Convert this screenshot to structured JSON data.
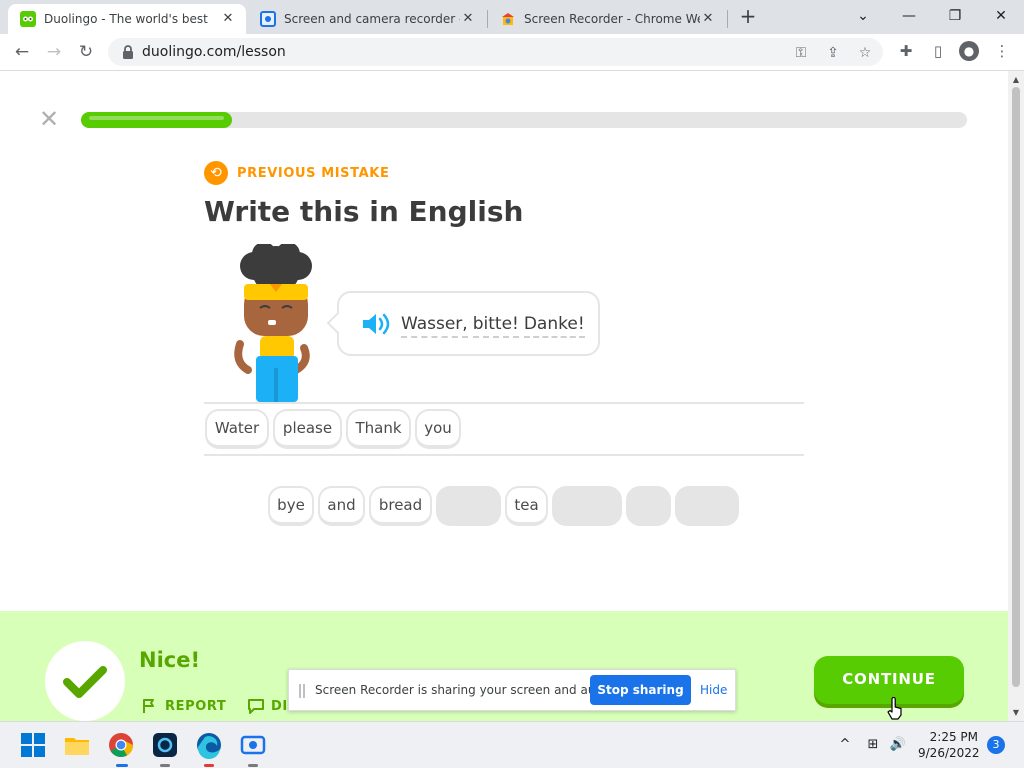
{
  "browser": {
    "tabs": [
      {
        "title": "Duolingo - The world's best"
      },
      {
        "title": "Screen and camera recorder - Sc"
      },
      {
        "title": "Screen Recorder - Chrome Web"
      }
    ],
    "url": "duolingo.com/lesson"
  },
  "lesson": {
    "progress": 0.17,
    "badge_label": "PREVIOUS MISTAKE",
    "heading": "Write this in English",
    "phrase_words": [
      "Wasser,",
      "bitte!",
      "Danke!"
    ],
    "answer_chips": [
      "Water",
      "please",
      "Thank",
      "you"
    ],
    "bank_chips": [
      "bye",
      "and",
      "bread",
      "",
      "tea",
      "",
      "",
      ""
    ]
  },
  "feedback": {
    "title": "Nice!",
    "report_label": "REPORT",
    "discuss_label": "DI",
    "continue_label": "CONTINUE"
  },
  "sharing_bar": {
    "message": "Screen Recorder is sharing your screen and audio.",
    "stop_label": "Stop sharing",
    "hide_label": "Hide"
  },
  "taskbar": {
    "time": "2:25 PM",
    "date": "9/26/2022",
    "notification_count": "3"
  },
  "colors": {
    "duo_green": "#58cc02",
    "duo_green_dark": "#58a700",
    "orange": "#ff9600",
    "feedback_bg": "#d7ffb8",
    "chrome_blue": "#1a73e8"
  }
}
